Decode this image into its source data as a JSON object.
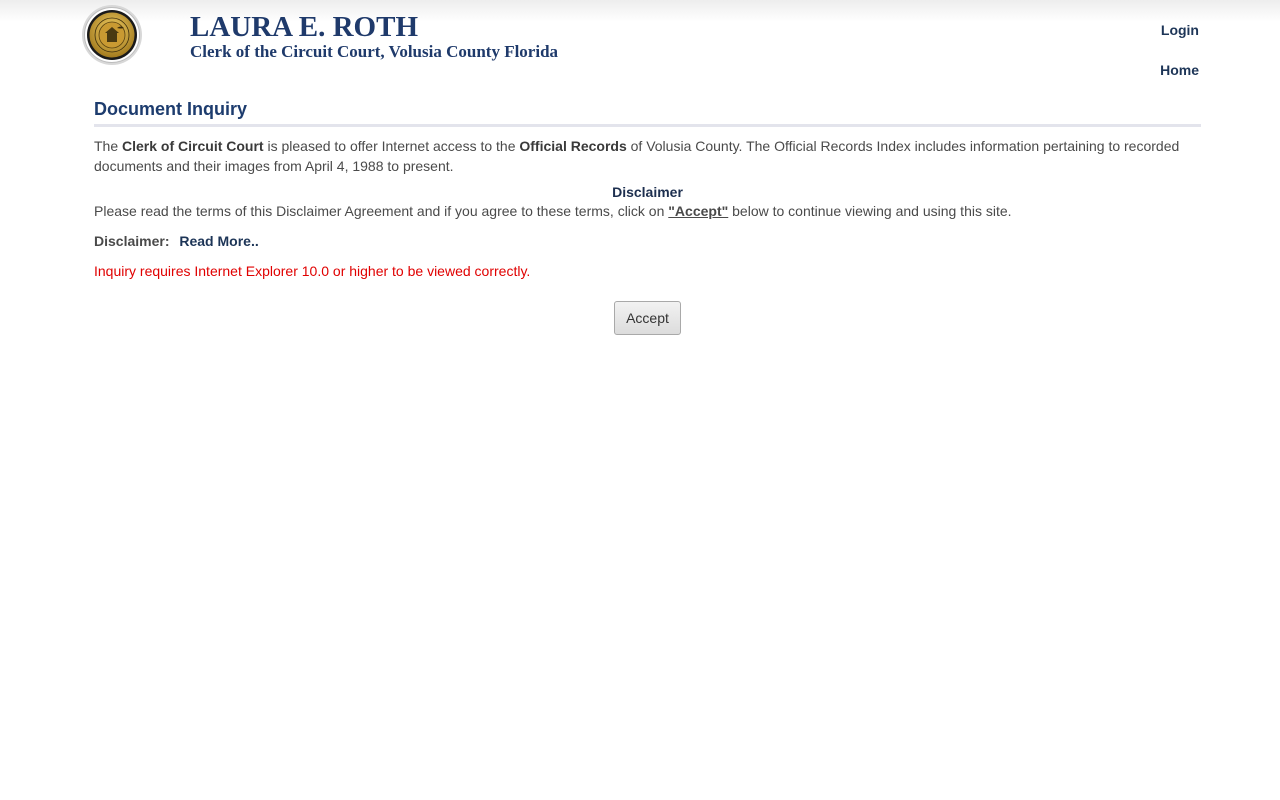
{
  "header": {
    "clerk_name": "LAURA E. ROTH",
    "clerk_title": "Clerk of the Circuit Court, Volusia County Florida",
    "seal_icon": "county-seal-icon",
    "nav": {
      "login": "Login",
      "home": "Home"
    }
  },
  "main": {
    "title": "Document Inquiry",
    "intro": {
      "p1": "The ",
      "b1": "Clerk of Circuit Court",
      "p2": " is pleased to offer Internet access to the ",
      "b2": "Official Records",
      "p3": " of Volusia County. The Official Records Index includes information pertaining to recorded documents and their images from April 4, 1988 to present."
    },
    "disclaimer": {
      "heading": "Disclaimer",
      "text_before": "Please read the terms of this Disclaimer Agreement and if you agree to these terms, click on ",
      "accept_ref": "\"Accept\"",
      "text_after": " below to continue viewing and using this site.",
      "label": "Disclaimer:",
      "read_more": "Read More.."
    },
    "warning": "Inquiry requires Internet Explorer 10.0 or higher to be viewed correctly.",
    "accept_button": "Accept"
  },
  "colors": {
    "brand_navy": "#1f3a6b",
    "link_navy": "#1d3557",
    "warning_red": "#e00000",
    "body_text": "#4a4a4a"
  }
}
